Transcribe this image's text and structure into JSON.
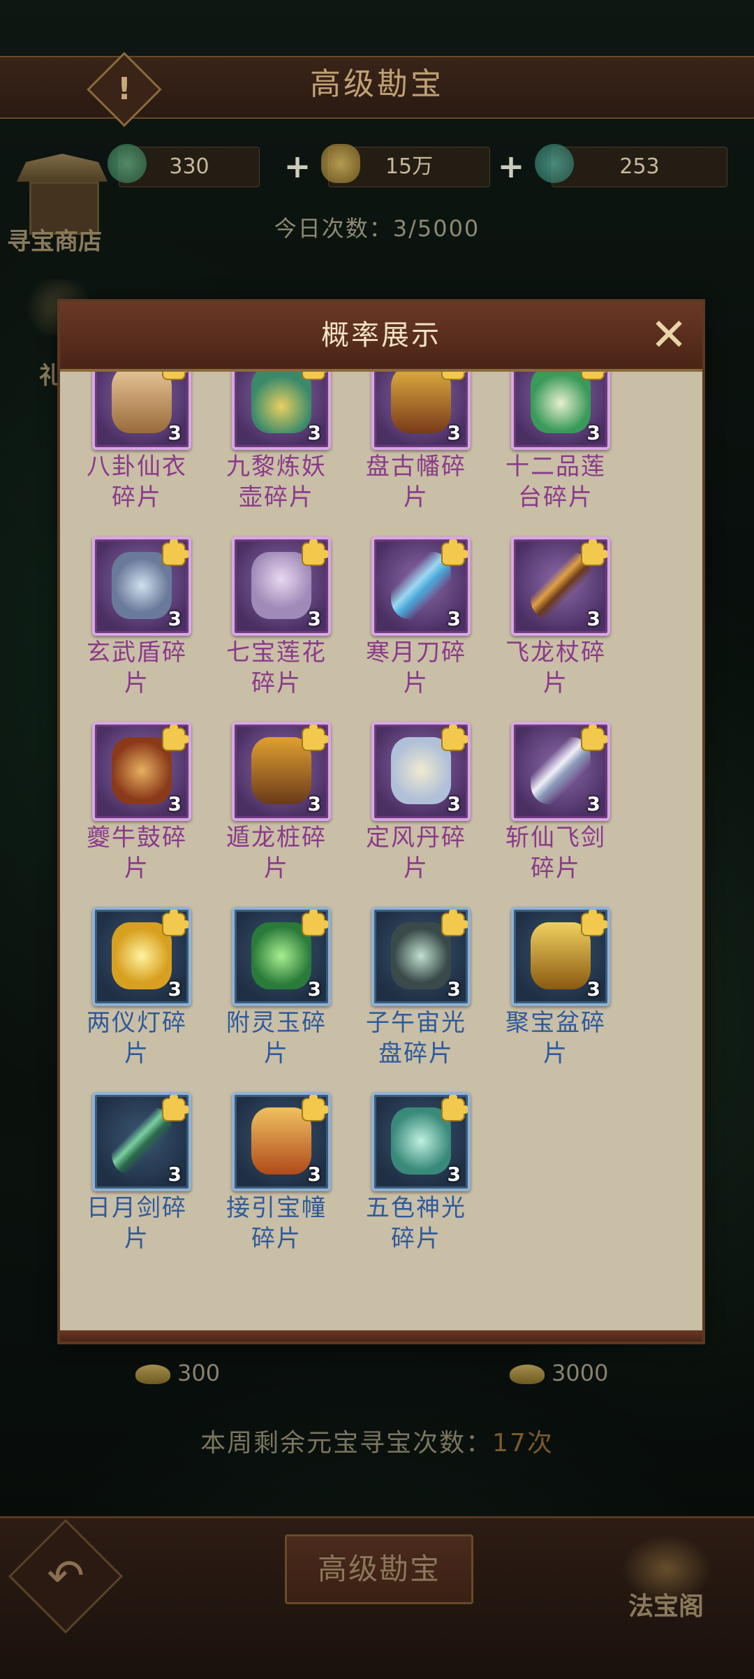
{
  "header": {
    "title": "高级勘宝",
    "help_icon": "!"
  },
  "resources": [
    {
      "value": "330",
      "icon": "jade-coin-icon",
      "color": "#3a8a6a"
    },
    {
      "value": "15万",
      "icon": "gold-ingot-icon",
      "color": "#e0b84a"
    },
    {
      "value": "253",
      "icon": "jade-ring-icon",
      "color": "#3a8a7a"
    }
  ],
  "shop": {
    "label": "寻宝商店"
  },
  "side_gift": {
    "label": "礼"
  },
  "today": {
    "text": "今日次数：3/5000"
  },
  "modal": {
    "title": "概率展示",
    "close": "✕",
    "items": [
      {
        "name": "八卦仙衣碎片",
        "line1": "八卦仙衣",
        "line2": "碎片",
        "count": "3",
        "rarity": "purple"
      },
      {
        "name": "九黎炼妖壶碎片",
        "line1": "九黎炼妖",
        "line2": "壶碎片",
        "count": "3",
        "rarity": "purple"
      },
      {
        "name": "盘古幡碎片",
        "line1": "盘古幡碎",
        "line2": "片",
        "count": "3",
        "rarity": "purple"
      },
      {
        "name": "十二品莲台碎片",
        "line1": "十二品莲",
        "line2": "台碎片",
        "count": "3",
        "rarity": "purple"
      },
      {
        "name": "玄武盾碎片",
        "line1": "玄武盾碎",
        "line2": "片",
        "count": "3",
        "rarity": "purple"
      },
      {
        "name": "七宝莲花碎片",
        "line1": "七宝莲花",
        "line2": "碎片",
        "count": "3",
        "rarity": "purple"
      },
      {
        "name": "寒月刀碎片",
        "line1": "寒月刀碎",
        "line2": "片",
        "count": "3",
        "rarity": "purple"
      },
      {
        "name": "飞龙杖碎片",
        "line1": "飞龙杖碎",
        "line2": "片",
        "count": "3",
        "rarity": "purple"
      },
      {
        "name": "夔牛鼓碎片",
        "line1": "夔牛鼓碎",
        "line2": "片",
        "count": "3",
        "rarity": "purple"
      },
      {
        "name": "遁龙桩碎片",
        "line1": "遁龙桩碎",
        "line2": "片",
        "count": "3",
        "rarity": "purple"
      },
      {
        "name": "定风丹碎片",
        "line1": "定风丹碎",
        "line2": "片",
        "count": "3",
        "rarity": "purple"
      },
      {
        "name": "斩仙飞剑碎片",
        "line1": "斩仙飞剑",
        "line2": "碎片",
        "count": "3",
        "rarity": "purple"
      },
      {
        "name": "两仪灯碎片",
        "line1": "两仪灯碎",
        "line2": "片",
        "count": "3",
        "rarity": "blue"
      },
      {
        "name": "附灵玉碎片",
        "line1": "附灵玉碎",
        "line2": "片",
        "count": "3",
        "rarity": "blue"
      },
      {
        "name": "子午宙光盘碎片",
        "line1": "子午宙光",
        "line2": "盘碎片",
        "count": "3",
        "rarity": "blue"
      },
      {
        "name": "聚宝盆碎片",
        "line1": "聚宝盆碎",
        "line2": "片",
        "count": "3",
        "rarity": "blue"
      },
      {
        "name": "日月剑碎片",
        "line1": "日月剑碎",
        "line2": "片",
        "count": "3",
        "rarity": "blue"
      },
      {
        "name": "接引宝幢碎片",
        "line1": "接引宝幢",
        "line2": "碎片",
        "count": "3",
        "rarity": "blue"
      },
      {
        "name": "五色神光碎片",
        "line1": "五色神光",
        "line2": "碎片",
        "count": "3",
        "rarity": "blue"
      }
    ]
  },
  "costs": [
    {
      "value": "300"
    },
    {
      "value": "3000"
    }
  ],
  "weekly": {
    "prefix": "本周剩余元宝寻宝次数：",
    "count": "17次"
  },
  "bottom": {
    "main_button": "高级勘宝",
    "back": "↶",
    "fabao_label": "法宝阁"
  }
}
